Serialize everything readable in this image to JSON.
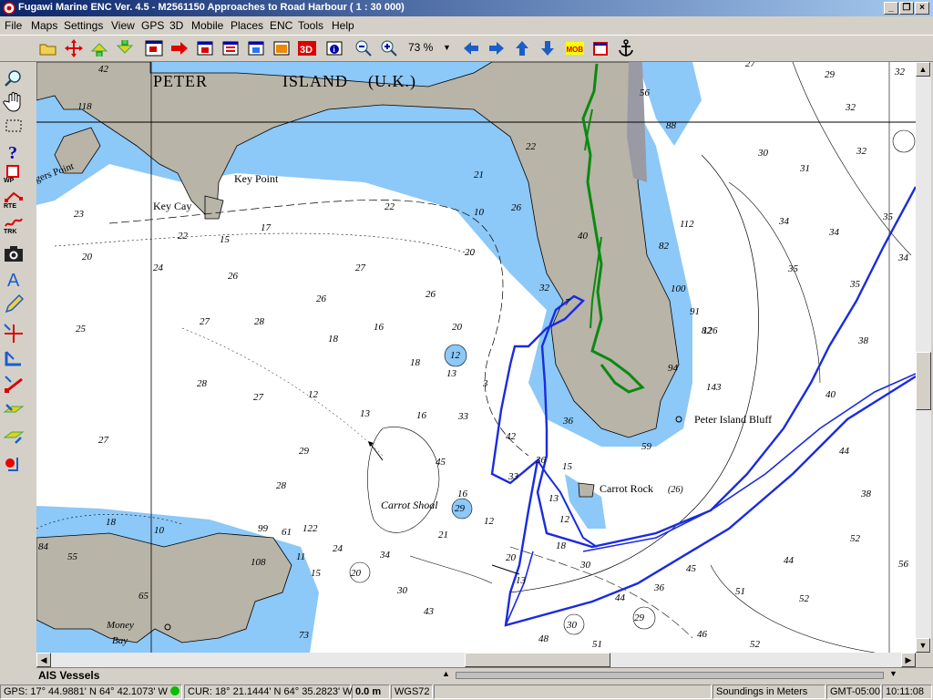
{
  "window": {
    "title": "Fugawi Marine ENC Ver. 4.5 - M2561150  Approaches to Road Harbour  ( 1 : 30 000)"
  },
  "menu": [
    "File",
    "Maps",
    "Settings",
    "View",
    "GPS",
    "3D",
    "Mobile",
    "Places",
    "ENC",
    "Tools",
    "Help"
  ],
  "toolbar": {
    "zoom": "73 %"
  },
  "left_tools": {
    "wp": "WP",
    "rte": "RTE",
    "trk": "TRK"
  },
  "map": {
    "places": [
      "PETER",
      "ISLAND",
      "(U.K.)",
      "Key Point",
      "Key Cay",
      "Carrot Shoal",
      "Carrot Rock",
      "(26)",
      "Peter Island Bluff",
      "Money",
      "Bay",
      "gers Point"
    ],
    "soundings": [
      "42",
      "32",
      "118",
      "27",
      "29",
      "32",
      "30",
      "31",
      "32",
      "34",
      "35",
      "34",
      "35",
      "34",
      "35",
      "38",
      "40",
      "44",
      "38",
      "52",
      "56",
      "44",
      "52",
      "51",
      "46",
      "52",
      "51",
      "48",
      "30",
      "29",
      "45",
      "36",
      "44",
      "30",
      "18",
      "20",
      "13",
      "43",
      "30",
      "34",
      "21",
      "29",
      "12",
      "20",
      "24",
      "15",
      "11",
      "61",
      "122",
      "99",
      "108",
      "65",
      "73",
      "84",
      "10",
      "18",
      "55",
      "27",
      "28",
      "27",
      "29",
      "28",
      "20",
      "25",
      "24",
      "26",
      "27",
      "28",
      "22",
      "17",
      "10",
      "23",
      "20",
      "26",
      "27",
      "26",
      "20",
      "16",
      "18",
      "12",
      "22",
      "15",
      "18",
      "13",
      "16",
      "12",
      "13",
      "33",
      "16",
      "45",
      "42",
      "3",
      "33",
      "36",
      "13",
      "12",
      "15",
      "91",
      "82",
      "94",
      "88",
      "7",
      "56",
      "82",
      "100",
      "112",
      "126",
      "143",
      "36",
      "32",
      "21",
      "26",
      "22",
      "40",
      "59"
    ]
  },
  "status": {
    "gps": "GPS: 17° 44.9881' N 64° 42.1073' W",
    "cur": "CUR: 18° 21.1444' N 64° 35.2823' W",
    "dist": "0.0 m",
    "datum": "WGS72",
    "soundings": "Soundings in Meters",
    "tz": "GMT-05:00",
    "time": "10:11:08"
  },
  "ais_label": "AIS Vessels",
  "colors": {
    "land": "#b8b4a8",
    "shallow": "#8cc8f8",
    "deep": "#ffffff",
    "route": "#1a2be0",
    "track": "#0a8a10"
  }
}
